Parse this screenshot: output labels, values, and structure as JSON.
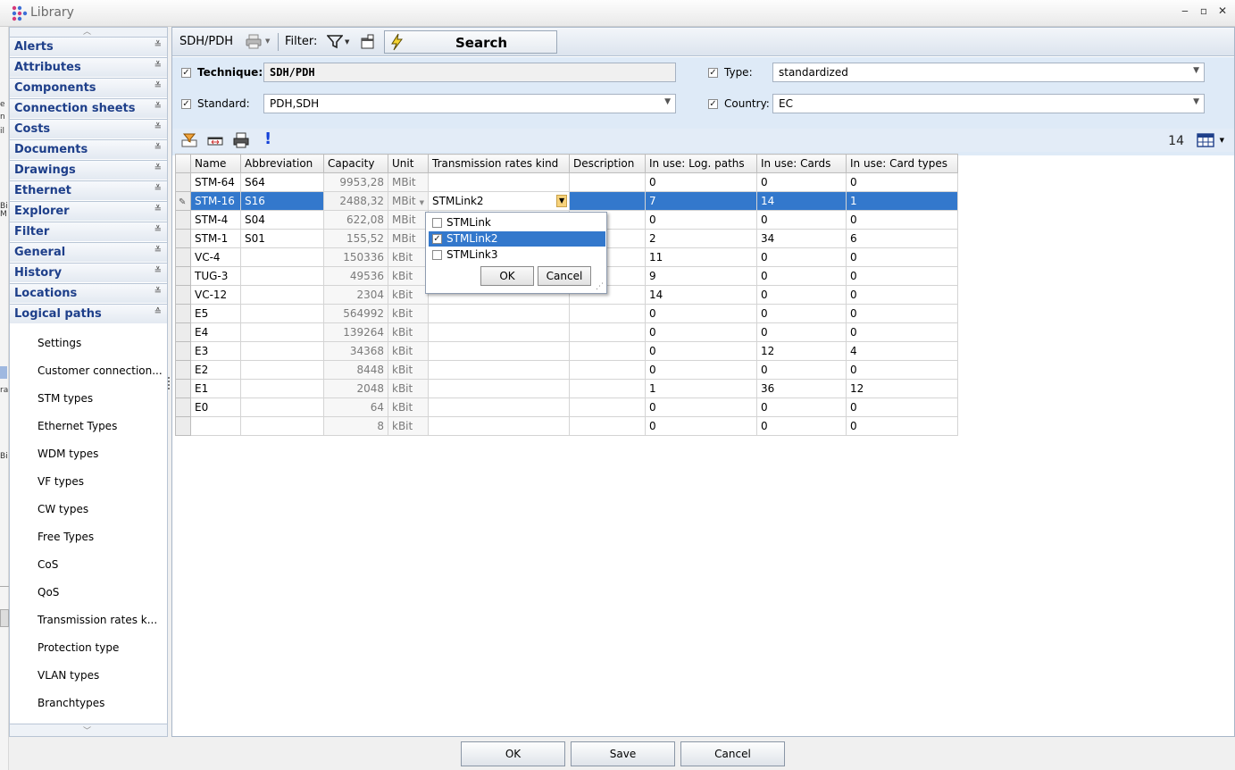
{
  "window": {
    "title": "Library",
    "minimize": "‒",
    "maximize": "▫",
    "close": "✕"
  },
  "sidebar": {
    "groups": [
      {
        "label": "Alerts",
        "expanded": false
      },
      {
        "label": "Attributes",
        "expanded": false
      },
      {
        "label": "Components",
        "expanded": false
      },
      {
        "label": "Connection sheets",
        "expanded": false
      },
      {
        "label": "Costs",
        "expanded": false
      },
      {
        "label": "Documents",
        "expanded": false
      },
      {
        "label": "Drawings",
        "expanded": false
      },
      {
        "label": "Ethernet",
        "expanded": false
      },
      {
        "label": "Explorer",
        "expanded": false
      },
      {
        "label": "Filter",
        "expanded": false
      },
      {
        "label": "General",
        "expanded": false
      },
      {
        "label": "History",
        "expanded": false
      },
      {
        "label": "Locations",
        "expanded": false
      },
      {
        "label": "Logical paths",
        "expanded": true
      }
    ],
    "items": [
      "Settings",
      "Customer connection...",
      "STM types",
      "Ethernet Types",
      "WDM types",
      "VF types",
      "CW types",
      "Free Types",
      "CoS",
      "QoS",
      "Transmission rates k...",
      "Protection type",
      "VLAN types",
      "Branchtypes"
    ]
  },
  "toolbar": {
    "context": "SDH/PDH",
    "filter_label": "Filter:",
    "search_label": "Search"
  },
  "filters": {
    "technique_label": "Technique:",
    "technique_value": "SDH/PDH",
    "standard_label": "Standard:",
    "standard_value": "PDH,SDH",
    "type_label": "Type:",
    "type_value": "standardized",
    "country_label": "Country:",
    "country_value": "EC",
    "technique_checked": true,
    "standard_checked": true,
    "type_checked": true,
    "country_checked": true
  },
  "grid": {
    "record_count": "14",
    "columns": [
      "Name",
      "Abbreviation",
      "Capacity",
      "Unit",
      "Transmission rates kind",
      "Description",
      "In use: Log. paths",
      "In use: Cards",
      "In use: Card types"
    ],
    "rows": [
      {
        "name": "STM-64",
        "abbr": "S64",
        "capacity": "9953,28",
        "unit": "MBit",
        "kind": "",
        "desc": "",
        "log_paths": "0",
        "cards": "0",
        "card_types": "0"
      },
      {
        "name": "STM-16",
        "abbr": "S16",
        "capacity": "2488,32",
        "unit": "MBit",
        "kind": "STMLink2",
        "desc": "",
        "log_paths": "7",
        "cards": "14",
        "card_types": "1"
      },
      {
        "name": "STM-4",
        "abbr": "S04",
        "capacity": "622,08",
        "unit": "MBit",
        "kind": "",
        "desc": "",
        "log_paths": "0",
        "cards": "0",
        "card_types": "0"
      },
      {
        "name": "STM-1",
        "abbr": "S01",
        "capacity": "155,52",
        "unit": "MBit",
        "kind": "",
        "desc": "",
        "log_paths": "2",
        "cards": "34",
        "card_types": "6"
      },
      {
        "name": "VC-4",
        "abbr": "",
        "capacity": "150336",
        "unit": "kBit",
        "kind": "",
        "desc": "",
        "log_paths": "11",
        "cards": "0",
        "card_types": "0"
      },
      {
        "name": "TUG-3",
        "abbr": "",
        "capacity": "49536",
        "unit": "kBit",
        "kind": "",
        "desc": "",
        "log_paths": "9",
        "cards": "0",
        "card_types": "0"
      },
      {
        "name": "VC-12",
        "abbr": "",
        "capacity": "2304",
        "unit": "kBit",
        "kind": "",
        "desc": "",
        "log_paths": "14",
        "cards": "0",
        "card_types": "0"
      },
      {
        "name": "E5",
        "abbr": "",
        "capacity": "564992",
        "unit": "kBit",
        "kind": "",
        "desc": "",
        "log_paths": "0",
        "cards": "0",
        "card_types": "0"
      },
      {
        "name": "E4",
        "abbr": "",
        "capacity": "139264",
        "unit": "kBit",
        "kind": "",
        "desc": "",
        "log_paths": "0",
        "cards": "0",
        "card_types": "0"
      },
      {
        "name": "E3",
        "abbr": "",
        "capacity": "34368",
        "unit": "kBit",
        "kind": "",
        "desc": "",
        "log_paths": "0",
        "cards": "12",
        "card_types": "4"
      },
      {
        "name": "E2",
        "abbr": "",
        "capacity": "8448",
        "unit": "kBit",
        "kind": "",
        "desc": "",
        "log_paths": "0",
        "cards": "0",
        "card_types": "0"
      },
      {
        "name": "E1",
        "abbr": "",
        "capacity": "2048",
        "unit": "kBit",
        "kind": "",
        "desc": "",
        "log_paths": "1",
        "cards": "36",
        "card_types": "12"
      },
      {
        "name": "E0",
        "abbr": "",
        "capacity": "64",
        "unit": "kBit",
        "kind": "",
        "desc": "",
        "log_paths": "0",
        "cards": "0",
        "card_types": "0"
      },
      {
        "name": "",
        "abbr": "",
        "capacity": "8",
        "unit": "kBit",
        "kind": "",
        "desc": "",
        "log_paths": "0",
        "cards": "0",
        "card_types": "0"
      }
    ],
    "selected_row": 1
  },
  "popup": {
    "options": [
      {
        "label": "STMLink",
        "checked": false
      },
      {
        "label": "STMLink2",
        "checked": true
      },
      {
        "label": "STMLink3",
        "checked": false
      }
    ],
    "ok_label": "OK",
    "cancel_label": "Cancel"
  },
  "footer": {
    "ok_label": "OK",
    "save_label": "Save",
    "cancel_label": "Cancel"
  },
  "colors": {
    "selection": "#3378cc",
    "group_header_text": "#1e3f8a",
    "filter_panel": "#deeaf7"
  }
}
